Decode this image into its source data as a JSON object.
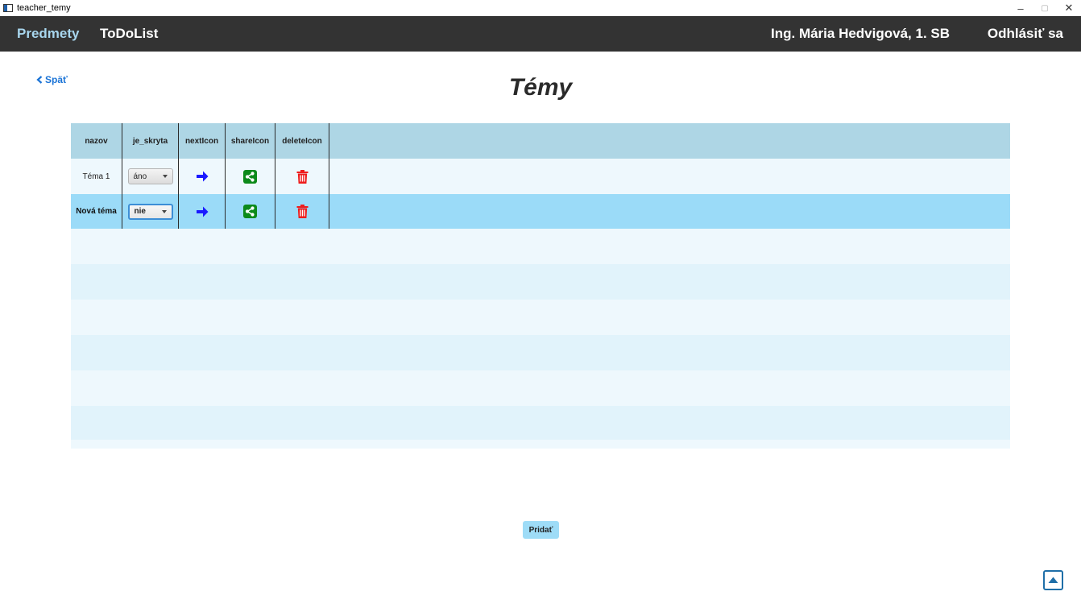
{
  "window": {
    "title": "teacher_temy"
  },
  "nav": {
    "predmety": "Predmety",
    "todolist": "ToDoList",
    "user": "Ing. Mária Hedvigová, 1. SB",
    "logout": "Odhlásiť sa"
  },
  "back_label": "Späť",
  "page_title": "Témy",
  "table": {
    "columns": [
      "nazov",
      "je_skryta",
      "nextIcon",
      "shareIcon",
      "deleteIcon"
    ],
    "rows": [
      {
        "nazov": "Téma 1",
        "je_skryta": "áno"
      },
      {
        "nazov": "Nová téma",
        "je_skryta": "nie"
      }
    ]
  },
  "add_button": "Pridať",
  "colors": {
    "navbar": "#333333",
    "nav_active": "#a8d6ee",
    "header": "#aed6e5",
    "selected_row": "#9bdbf8",
    "next_arrow": "#1a1aff",
    "share": "#0c8a1a",
    "delete": "#ee1c1c"
  },
  "icons": [
    "arrow-right-icon",
    "share-icon",
    "trash-icon",
    "scroll-top-icon",
    "chevron-left-icon"
  ]
}
